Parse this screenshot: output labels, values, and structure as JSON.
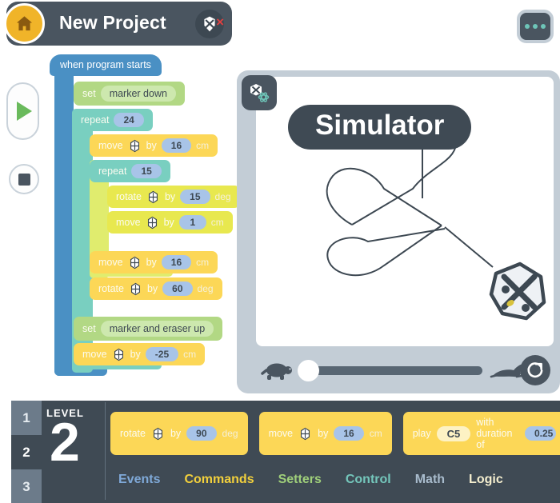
{
  "header": {
    "home_icon": "home-icon",
    "project_title": "New Project",
    "robot_icon": "robot-icon",
    "disconnect_mark": "×",
    "menu_icon": "more-options-icon"
  },
  "run_controls": {
    "play_label": "play-icon",
    "stop_label": "stop-icon"
  },
  "workspace": {
    "hat_block": "when program starts",
    "blocks": [
      {
        "type": "set",
        "label": "set",
        "value": "marker down"
      },
      {
        "type": "repeat",
        "label": "repeat",
        "value": "24"
      },
      {
        "type": "move",
        "label": "move",
        "by": "by",
        "value": "16",
        "unit": "cm"
      },
      {
        "type": "repeat",
        "label": "repeat",
        "value": "15"
      },
      {
        "type": "rotate",
        "label": "rotate",
        "by": "by",
        "value": "15",
        "unit": "deg"
      },
      {
        "type": "move",
        "label": "move",
        "by": "by",
        "value": "1",
        "unit": "cm"
      },
      {
        "type": "move",
        "label": "move",
        "by": "by",
        "value": "16",
        "unit": "cm"
      },
      {
        "type": "rotate",
        "label": "rotate",
        "by": "by",
        "value": "60",
        "unit": "deg"
      },
      {
        "type": "set",
        "label": "set",
        "value": "marker and eraser up"
      },
      {
        "type": "move",
        "label": "move",
        "by": "by",
        "value": "-25",
        "unit": "cm"
      }
    ]
  },
  "simulator": {
    "tab_icon": "simulator-tab-icon",
    "title": "Simulator",
    "slow_icon": "turtle-icon",
    "fast_icon": "rabbit-icon",
    "reset_icon": "reset-icon",
    "speed_value": 0
  },
  "bottom": {
    "level_word": "LEVEL",
    "level_number": "2",
    "levels": [
      "1",
      "2",
      "3"
    ],
    "selected_level": "2",
    "palette_blocks": [
      {
        "label": "rotate",
        "by": "by",
        "value": "90",
        "unit": "deg"
      },
      {
        "label": "move",
        "by": "by",
        "value": "16",
        "unit": "cm"
      },
      {
        "label": "play",
        "note": "C5",
        "mid": "with duration of",
        "value": "0.25"
      }
    ],
    "categories": [
      {
        "label": "Events",
        "color": "#7fa9d8"
      },
      {
        "label": "Commands",
        "color": "#f2d03c"
      },
      {
        "label": "Setters",
        "color": "#9fcf7a"
      },
      {
        "label": "Control",
        "color": "#74c6bb"
      },
      {
        "label": "Math",
        "color": "#a8bbcc"
      },
      {
        "label": "Logic",
        "color": "#f5efcf"
      }
    ],
    "active_category": "Commands"
  },
  "colors": {
    "panel_dark": "#3f4a54",
    "header_gray": "#4a5560",
    "accent_yellow": "#fcd757",
    "accent_green": "#b2d884",
    "accent_teal": "#79cfc0",
    "accent_blue": "#4a90c4",
    "home_orange": "#f0b429"
  }
}
